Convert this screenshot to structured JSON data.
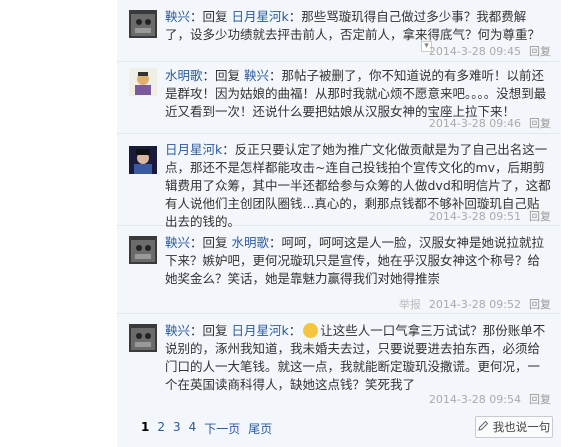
{
  "replies": [
    {
      "username": "鞅兴",
      "prefix": "：",
      "reply_word": "回复",
      "reply_to": "日月星河k",
      "body": "：那些骂璇玑得自己做过多少事？我都费解了，设多少功绩就去抨击前人，否定前人，拿来得底气？何为尊重？",
      "time": "2014-3-28 09:45",
      "reply_label": "回复"
    },
    {
      "username": "水明歌",
      "prefix": "：",
      "reply_word": "回复",
      "reply_to": "鞅兴",
      "body": "：那帖子被删了，你不知道说的有多难听！以前还是群攻！因为姑娘的曲福！从那时我就心烦不愿意来吧。。。。没想到最近又看到一次！还说什么要把姑娘从汉服女神的宝座上拉下来！",
      "time": "2014-3-28 09:46",
      "reply_label": "回复"
    },
    {
      "username": "日月星河k",
      "prefix": "：",
      "reply_word": "",
      "reply_to": "",
      "body": "反正只要认定了她为推广文化做贡献是为了自己出名这一点，那还不是怎样都能攻击~连自己投钱拍个宣传文化的mv，后期剪辑费用了众筹，其中一半还都给参与众筹的人做dvd和明信片了，这都有人说他们主创团队圈钱...真心的，剩那点钱都不够补回璇玑自己贴出去的钱的。",
      "time": "2014-3-28 09:51",
      "reply_label": "回复"
    },
    {
      "username": "鞅兴",
      "prefix": "：",
      "reply_word": "回复",
      "reply_to": "水明歌",
      "body": "：呵呵，呵呵这是人一脸，汉服女神是她说拉就拉下来？嫉妒吧，更何况璇玑只是宣传，她在乎汉服女神这个称号？给她奖金么？笑话，她是靠魅力赢得我们对她得推崇",
      "time": "2014-3-28 09:52",
      "reply_label": "回复",
      "report_label": "举报"
    },
    {
      "username": "鞅兴",
      "prefix": "：",
      "reply_word": "回复",
      "reply_to": "日月星河k",
      "body_pre": "：",
      "body": "让这些人一口气拿三万试试？那份账单不说别的，涿州我知道，我未婚夫去过，只要说要进去拍东西，必须给门口的人一大笔钱。就这一点，我就能断定璇玑没撒谎。更何况，一个在英国读商科得人，缺她这点钱？笑死我了",
      "time": "2014-3-28 09:54",
      "reply_label": "回复"
    }
  ],
  "pager": {
    "pages": [
      "1",
      "2",
      "3",
      "4"
    ],
    "current": "1",
    "next": "下一页",
    "last": "尾页"
  },
  "say_button": {
    "label": "我也说一句",
    "icon": "pencil-icon"
  },
  "expand_icon": "chevron-down-icon"
}
